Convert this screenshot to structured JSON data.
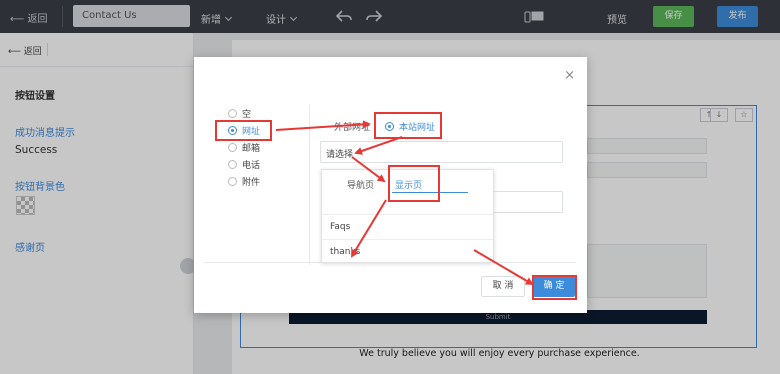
{
  "topbar": {
    "back_label": "返回",
    "page_name": "Contact Us",
    "menu_new": "新增",
    "menu_design": "设计",
    "preview_label": "预览",
    "save_label": "保存",
    "publish_label": "发布",
    "colors": {
      "bar": "#3b3e47",
      "save": "#5cb85c",
      "publish": "#3d8cdc"
    }
  },
  "left_panel": {
    "back_label": "返回",
    "heading": "按钮设置",
    "success_label": "成功消息提示",
    "success_value": "Success",
    "bg_color_label": "按钮背景色",
    "thanks_label": "感谢页"
  },
  "canvas": {
    "submit_label": "Submit",
    "footer_text": "We truly believe you will enjoy every purchase experience."
  },
  "modal": {
    "link_types": [
      {
        "label": "空",
        "selected": false
      },
      {
        "label": "网址",
        "selected": true
      },
      {
        "label": "邮箱",
        "selected": false
      },
      {
        "label": "电话",
        "selected": false
      },
      {
        "label": "附件",
        "selected": false
      }
    ],
    "external_link_label": "外部网址",
    "site_link_label": "本站网址",
    "select_placeholder": "请选择",
    "dropdown_tabs": {
      "nav_pages": "导航页",
      "hidden_pages": "显示页"
    },
    "dropdown_items": [
      "Faqs",
      "thanks"
    ],
    "cancel_label": "取 消",
    "confirm_label": "确 定",
    "accent_color": "#3d8cdc",
    "annotation_color": "#e53935"
  }
}
